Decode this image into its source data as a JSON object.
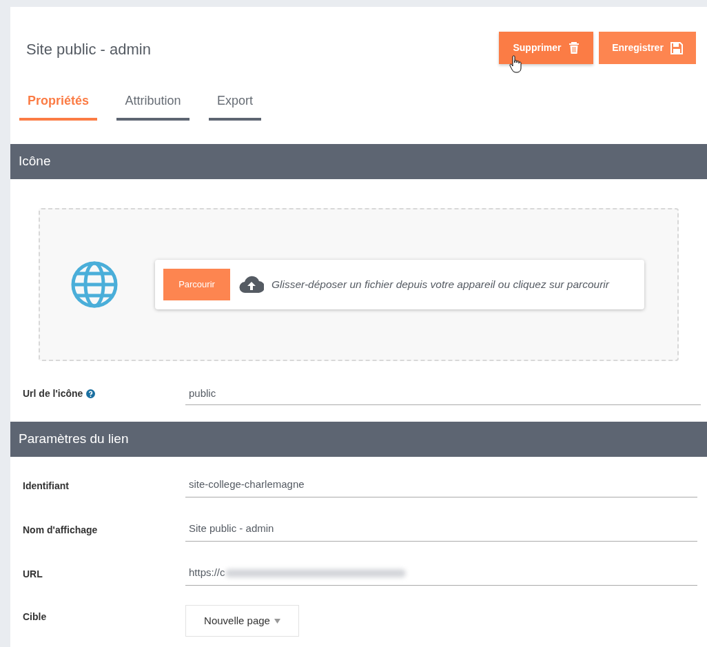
{
  "header": {
    "title": "Site public - admin",
    "buttons": [
      {
        "label": "Supprimer",
        "kind": "delete",
        "hovered": true
      },
      {
        "label": "Enregistrer",
        "kind": "save",
        "hovered": false
      }
    ]
  },
  "tabs": [
    {
      "label": "Propriétés",
      "selected": true
    },
    {
      "label": "Attribution",
      "selected": false
    },
    {
      "label": "Export",
      "selected": false
    }
  ],
  "icon_section": {
    "title": "Icône",
    "upload": {
      "button": "Parcourir",
      "hint": "Glisser-déposer un fichier depuis votre appareil ou cliquez sur parcourir"
    },
    "url_field": {
      "label": "Url de l'icône",
      "value": "public"
    }
  },
  "link_section": {
    "title": "Paramètres du lien",
    "fields": [
      {
        "label": "Identifiant",
        "kind": "text",
        "value": "site-college-charlemagne"
      },
      {
        "label": "Nom d'affichage",
        "kind": "text",
        "value": "Site public - admin"
      },
      {
        "label": "URL",
        "kind": "text",
        "value": "https://c",
        "blurred": true
      },
      {
        "label": "Cible",
        "kind": "select",
        "value": "Nouvelle page"
      }
    ]
  }
}
